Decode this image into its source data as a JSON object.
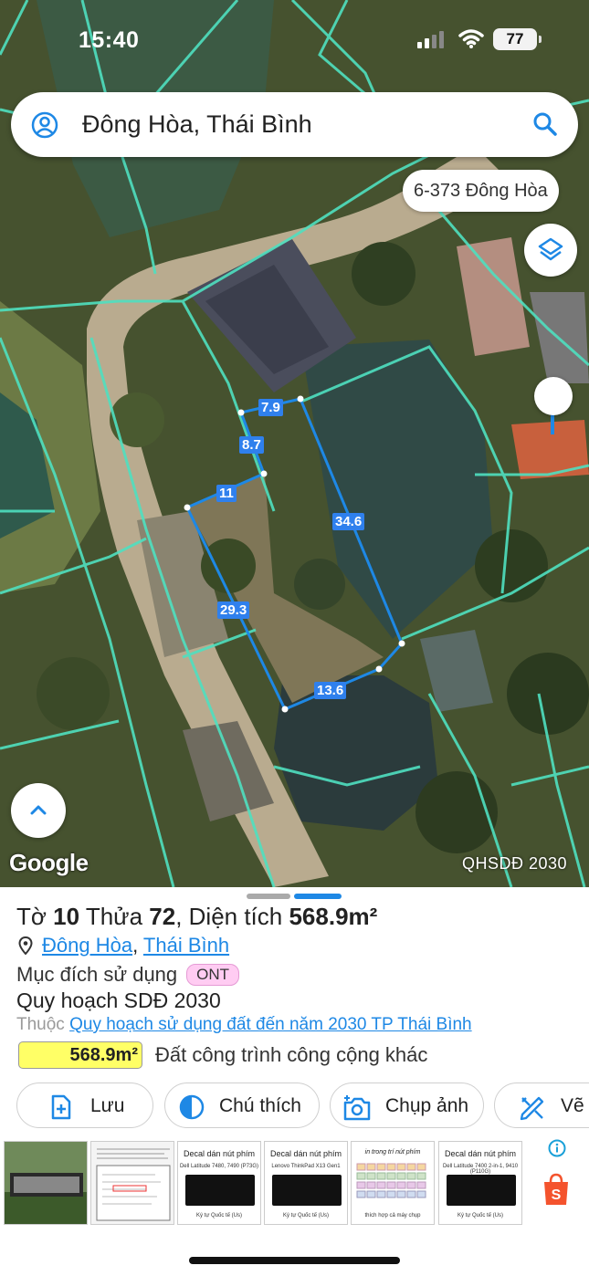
{
  "status_bar": {
    "time": "15:40",
    "battery": "77"
  },
  "search": {
    "query": "Đông Hòa, Thái Bình",
    "account_icon": "account-circle-icon",
    "search_icon": "magnifier-icon"
  },
  "map": {
    "address_chip": "6-373 Đông Hòa",
    "attribution": "Google",
    "layer_label": "QHSDĐ 2030",
    "dimensions": [
      "7.9",
      "8.7",
      "11",
      "34.6",
      "29.3",
      "13.6"
    ],
    "colors": {
      "boundary": "#1e88e5",
      "parcel_lines": "#4fe0c0",
      "accent": "#1e88e5"
    }
  },
  "parcel": {
    "title_prefix": "Tờ ",
    "sheet_no": "10",
    "title_mid": " Thửa ",
    "parcel_no": "72",
    "title_area_prefix": ", Diện tích ",
    "area": "568.9m²",
    "commune": "Đông Hòa",
    "separator": ",",
    "province": "Thái Bình",
    "purpose_label": "Mục đích sử dụng",
    "purpose_code": "ONT",
    "plan_title": "Quy hoạch SDĐ 2030",
    "belongs_prefix": "Thuộc",
    "belongs_link": "Quy hoạch sử dụng đất đến năm 2030 TP Thái Bình",
    "area_badge": "568.9m²",
    "area_use": "Đất công trình công cộng khác"
  },
  "actions": [
    {
      "label": "Lưu",
      "icon": "save-plus-icon"
    },
    {
      "label": "Chú thích",
      "icon": "contrast-icon"
    },
    {
      "label": "Chụp ảnh",
      "icon": "add-camera-icon"
    },
    {
      "label": "Vẽ",
      "icon": "draw-ruler-icon"
    }
  ],
  "ads": {
    "thumbs": [
      {
        "caption": "Decal dán nút phím",
        "model": "Dell Latitude 7480, 7490 (P73G)",
        "footer": "Ký tự Quốc tế (Us)"
      },
      {
        "caption": "Decal dán nút phím",
        "model": "Lenovo ThinkPad X13 Gen1",
        "footer": "Ký tự Quốc tế (Us)"
      },
      {
        "caption": "in trong trí nút phím",
        "model": "",
        "footer": "thích hợp cả máy chụp"
      },
      {
        "caption": "Decal dán nút phím",
        "model": "Dell Latitude 7400 2-in-1, 9410 (P110G)",
        "footer": "Ký tự Quốc tế (Us)"
      }
    ],
    "info_icon": "info-icon",
    "shop_icon": "shopee-bag-icon"
  }
}
